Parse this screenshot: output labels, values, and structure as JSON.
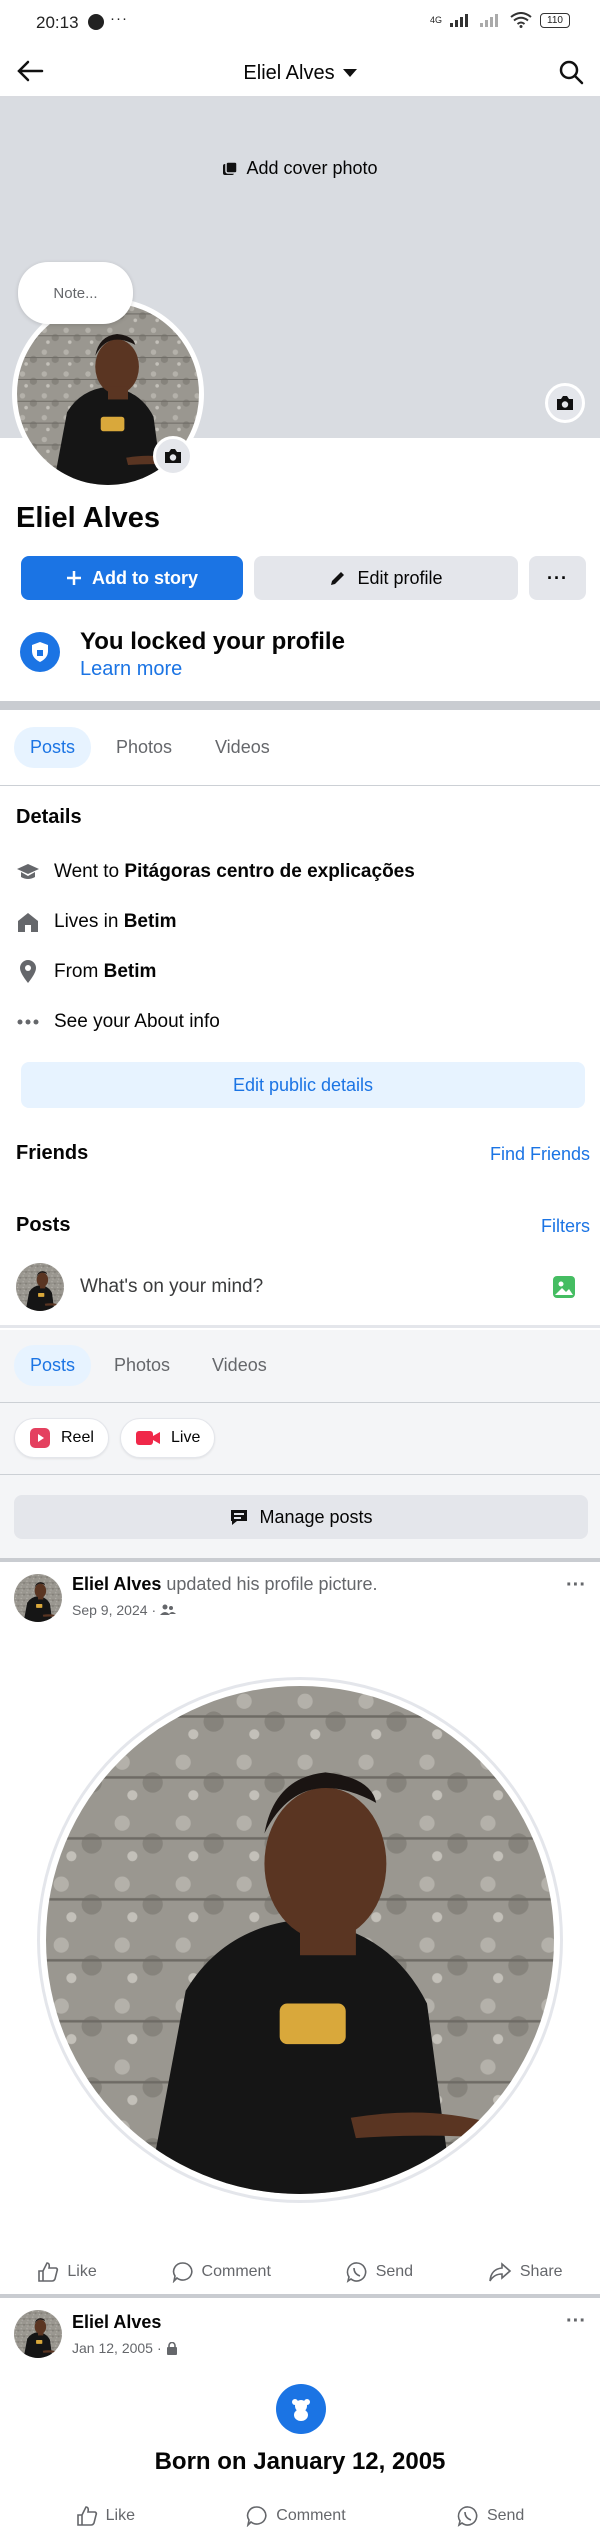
{
  "status": {
    "time": "20:13",
    "more": "···",
    "network": "4G",
    "battery": "110"
  },
  "nav": {
    "title": "Eliel Alves"
  },
  "cover": {
    "add_cover_label": "Add cover photo"
  },
  "profile": {
    "note_placeholder": "Note...",
    "name": "Eliel Alves"
  },
  "actions": {
    "add_story": "Add to story",
    "edit_profile": "Edit profile",
    "more": "···"
  },
  "locked": {
    "title": "You locked your profile",
    "learn_more": "Learn more"
  },
  "tabs": [
    "Posts",
    "Photos",
    "Videos"
  ],
  "details": {
    "heading": "Details",
    "items": [
      {
        "icon": "education-icon",
        "prefix": "Went to ",
        "value": "Pitágoras centro de explicações"
      },
      {
        "icon": "home-icon",
        "prefix": "Lives in ",
        "value": "Betim"
      },
      {
        "icon": "location-pin-icon",
        "prefix": "From ",
        "value": "Betim"
      },
      {
        "icon": "ellipsis-icon",
        "prefix": "See your About info",
        "value": ""
      }
    ],
    "edit_public": "Edit public details"
  },
  "friends": {
    "heading": "Friends",
    "link": "Find Friends"
  },
  "posts_section": {
    "heading": "Posts",
    "filters": "Filters",
    "composer_placeholder": "What's on your mind?"
  },
  "post_tabs": [
    "Posts",
    "Photos",
    "Videos"
  ],
  "create": {
    "reel": "Reel",
    "live": "Live"
  },
  "manage_posts": "Manage posts",
  "post1": {
    "author": "Eliel Alves",
    "action_text": " updated his profile picture.",
    "date": "Sep 9, 2024",
    "dot": "·",
    "more": "···",
    "actions": [
      "Like",
      "Comment",
      "Send",
      "Share"
    ]
  },
  "post2": {
    "author": "Eliel Alves",
    "date": "Jan 12, 2005",
    "dot": "·",
    "more": "···",
    "life_event": "Born on January 12, 2005",
    "actions": [
      "Like",
      "Comment",
      "Send"
    ]
  },
  "colors": {
    "accent": "#1b74e4",
    "cover": "#d9dce1",
    "button_gray": "#e4e6eb",
    "tab_active_bg": "#e7f3ff"
  }
}
